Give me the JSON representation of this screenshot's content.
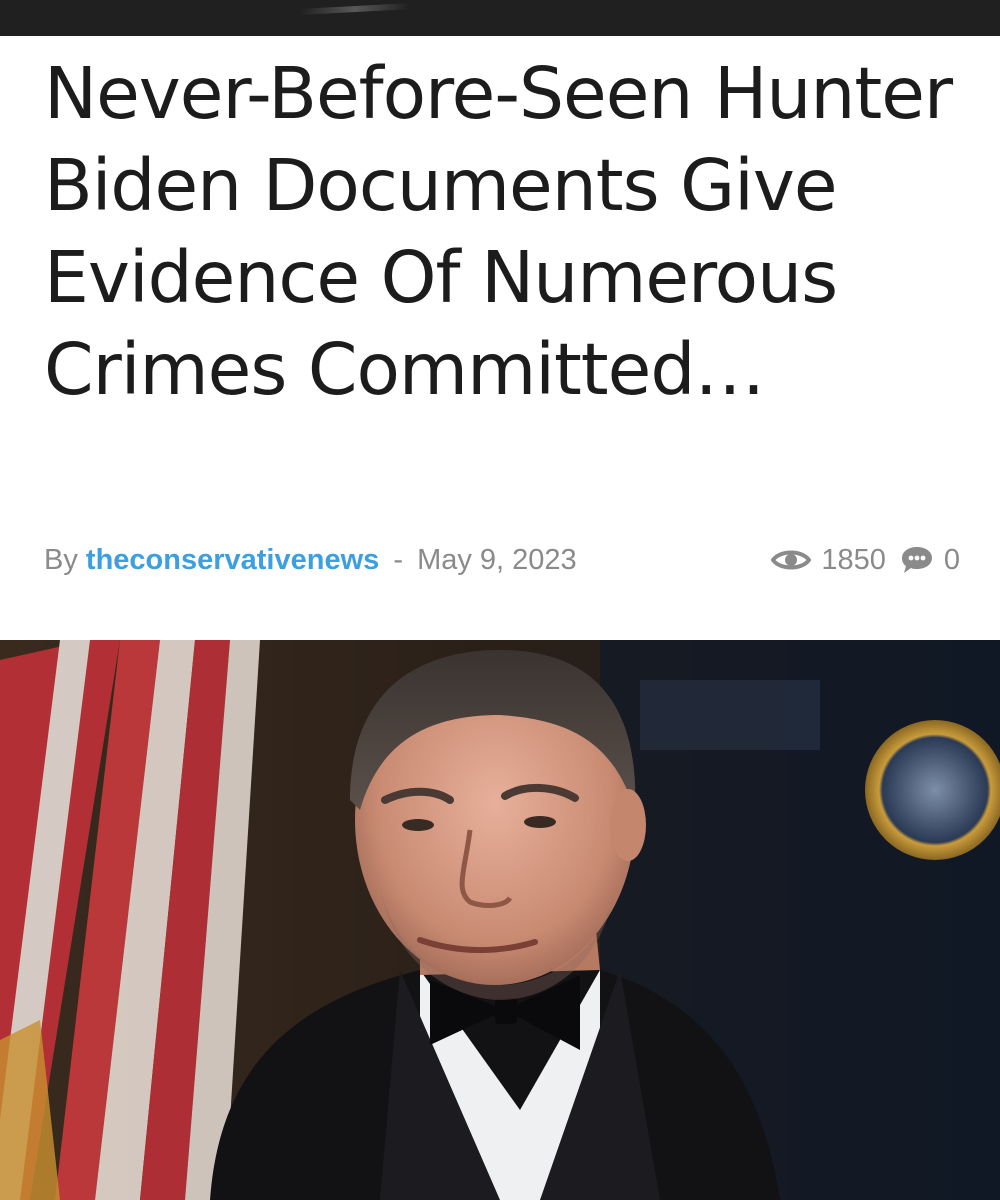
{
  "article": {
    "title": "Never-Before-Seen Hunter Biden Documents Give Evidence Of Numerous Crimes Committed…",
    "by_label": "By",
    "author": "theconservativenews",
    "separator": "-",
    "date": "May 9, 2023",
    "views": "1850",
    "comments": "0"
  },
  "icons": {
    "views": "eye-icon",
    "comments": "comment-bubble-icon"
  },
  "colors": {
    "author_link": "#3b9fe0",
    "meta_text": "#8a8a8a",
    "title_text": "#1c1c1c",
    "top_bar": "#202020"
  }
}
